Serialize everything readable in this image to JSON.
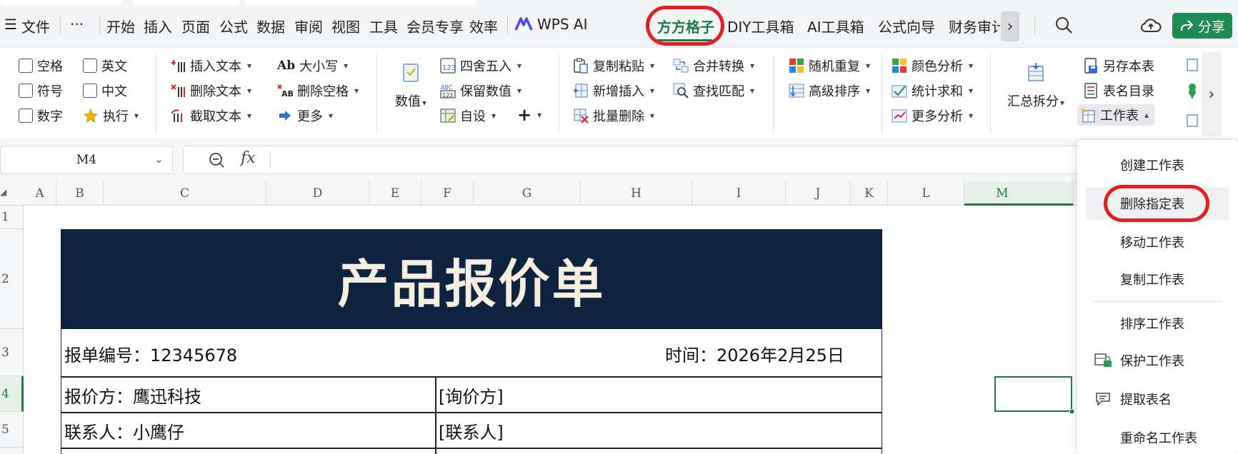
{
  "menu": {
    "hamburger": "☰",
    "file": "文件",
    "more": "···",
    "tabs": [
      "开始",
      "插入",
      "页面",
      "公式",
      "数据",
      "审阅",
      "视图",
      "工具",
      "会员专享",
      "效率"
    ],
    "wps_ai": "WPS AI",
    "fangfang": "方方格子",
    "diy": "DIY工具箱",
    "ai_box": "AI工具箱",
    "formula_guide": "公式向导",
    "finance": "财务审计",
    "share": "分享",
    "colors": {
      "accent": "#1e7b48",
      "share_bg": "#1e8a55",
      "highlight": "#e41f1f"
    }
  },
  "ribbon": {
    "checks": [
      "空格",
      "英文",
      "符号",
      "中文",
      "数字"
    ],
    "execute": "执行",
    "insert_text": "插入文本",
    "delete_text": "删除文本",
    "extract_text": "截取文本",
    "case": "大小写",
    "case_icon": "Ab",
    "delete_space": "删除空格",
    "more": "更多",
    "value": "数值",
    "round": "四舍五入",
    "keep_value": "保留数值",
    "custom": "自设",
    "plus": "+",
    "copy_paste": "复制粘贴",
    "new_insert": "新增插入",
    "batch_delete": "批量删除",
    "merge_convert": "合并转换",
    "find_match": "查找匹配",
    "random_repeat": "随机重复",
    "adv_sort": "高级排序",
    "color_analysis": "颜色分析",
    "stat_sum": "统计求和",
    "more_analysis": "更多分析",
    "summary_split": "汇总拆分",
    "save_as_sheet": "另存本表",
    "sheet_dir": "表名目录",
    "sheet_order": "工作表"
  },
  "formula": {
    "cell_ref": "M4",
    "fx": "fx"
  },
  "columns": [
    "A",
    "B",
    "C",
    "D",
    "E",
    "F",
    "G",
    "H",
    "I",
    "J",
    "K",
    "L",
    "M"
  ],
  "active_column": "M",
  "rows": [
    "1",
    "2",
    "3",
    "4",
    "5"
  ],
  "active_row": "4",
  "sheet": {
    "title": "产品报价单",
    "quote_no": "报单编号：12345678",
    "time": "时间：2026年2月25日",
    "quoter": "报价方：鹰迅科技",
    "inquirer": "[询价方]",
    "contact": "联系人：小鹰仔",
    "contact2": "[联系人]",
    "colors": {
      "title_bg": "#0f2340",
      "title_fg": "#f4efe2"
    }
  },
  "dropdown": {
    "items": [
      {
        "label": "创建工作表",
        "icon": ""
      },
      {
        "label": "删除指定表",
        "icon": ""
      },
      {
        "label": "移动工作表",
        "icon": ""
      },
      {
        "label": "复制工作表",
        "icon": ""
      },
      {
        "label": "排序工作表",
        "icon": ""
      },
      {
        "label": "保护工作表",
        "icon": "protect-sheet-icon"
      },
      {
        "label": "提取表名",
        "icon": "extract-name-icon"
      },
      {
        "label": "重命名工作表",
        "icon": ""
      }
    ],
    "highlighted": "删除指定表"
  }
}
